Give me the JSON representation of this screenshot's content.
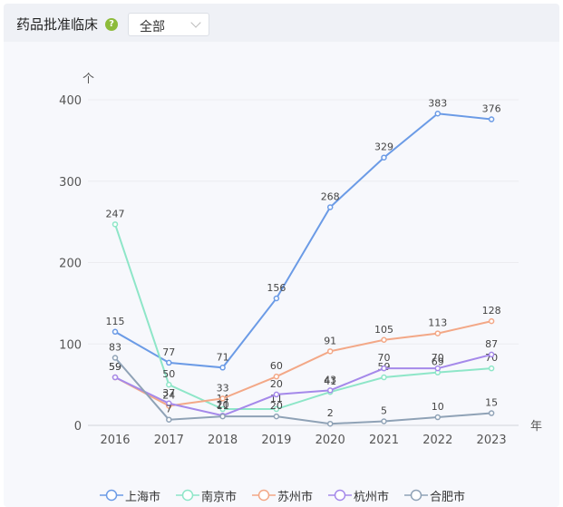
{
  "header": {
    "title": "药品批准临床",
    "help_icon": "question-circle-icon",
    "filter_value": "全部"
  },
  "chart_data": {
    "type": "line",
    "title": "",
    "xlabel": "",
    "ylabel": "",
    "y_unit": "个",
    "x_unit": "年",
    "categories": [
      "2016",
      "2017",
      "2018",
      "2019",
      "2020",
      "2021",
      "2022",
      "2023"
    ],
    "ylim": [
      0,
      400
    ],
    "yticks": [
      "0",
      "100",
      "200",
      "300",
      "400"
    ],
    "grid": true,
    "legend_position": "bottom",
    "series": [
      {
        "name": "上海市",
        "color": "#6b9be6",
        "values": [
          115,
          77,
          71,
          156,
          268,
          329,
          383,
          376
        ]
      },
      {
        "name": "南京市",
        "color": "#8ee6c8",
        "values": [
          247,
          50,
          20,
          20,
          41,
          59,
          65,
          70
        ]
      },
      {
        "name": "苏州市",
        "color": "#f3a887",
        "values": [
          59,
          24,
          33,
          60,
          91,
          105,
          113,
          128
        ]
      },
      {
        "name": "杭州市",
        "color": "#a589ea",
        "values": [
          59,
          27,
          12,
          38,
          43,
          70,
          70,
          87
        ]
      },
      {
        "name": "合肥市",
        "color": "#8fa2b6",
        "values": [
          83,
          7,
          11,
          11,
          2,
          5,
          10,
          15
        ]
      }
    ],
    "data_labels": [
      [
        "115",
        "77",
        "71",
        "156",
        "268",
        "329",
        "383",
        "376"
      ],
      [
        "247",
        "50",
        "14",
        "11",
        "41",
        "59",
        "69",
        "70"
      ],
      [
        "59",
        "24",
        "33",
        "60",
        "91",
        "105",
        "113",
        "128"
      ],
      [
        "59",
        "37",
        "20",
        "20",
        "43",
        "70",
        "70",
        "87"
      ],
      [
        "83",
        "7",
        "11",
        "20",
        "2",
        "5",
        "10",
        "15"
      ]
    ]
  }
}
